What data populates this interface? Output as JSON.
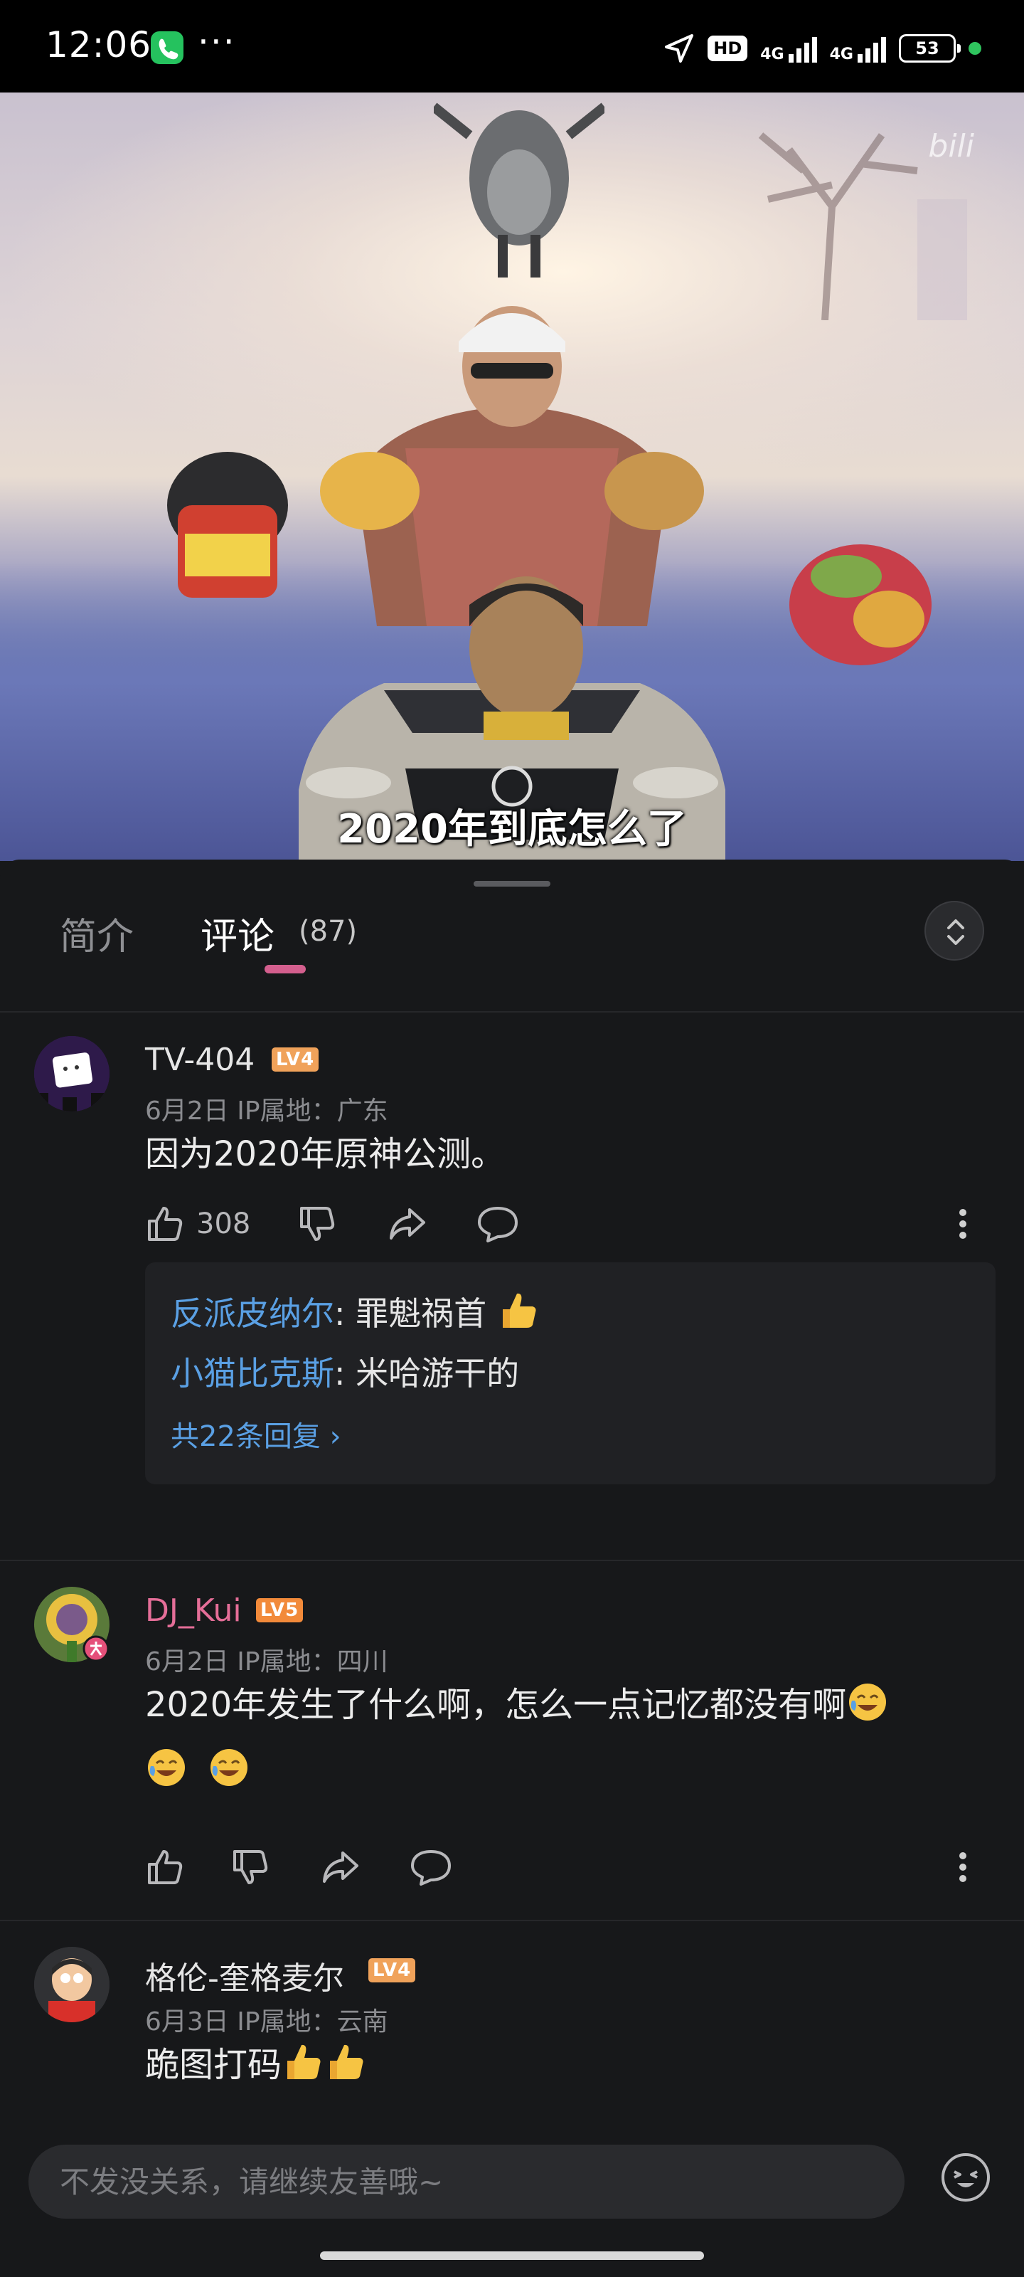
{
  "status_bar": {
    "time": "12:06",
    "more": "···",
    "hd": "HD",
    "net1": "4G",
    "net2": "4G",
    "battery": "53"
  },
  "video": {
    "caption": "2020年到底怎么了",
    "watermark": "bili"
  },
  "tabs": {
    "intro": "简介",
    "comments": "评论",
    "comments_count": "(87)"
  },
  "comments": [
    {
      "username": "TV-404",
      "username_color": "#e6e6e6",
      "level": "LV4",
      "level_color": "#f0a25a",
      "meta": "6月2日 IP属地：广东",
      "text": "因为2020年原神公测。",
      "likes": "308",
      "replies": [
        {
          "user": "反派皮纳尔",
          "text": ": 罪魁祸首"
        },
        {
          "user": "小猫比克斯",
          "text": ": 米哈游干的"
        }
      ],
      "reply_summary": "共22条回复 ›"
    },
    {
      "username": "DJ_Kui",
      "username_color": "#e56e98",
      "level": "LV5",
      "level_color": "#f28a3a",
      "meta": "6月2日 IP属地：四川",
      "text": "2020年发生了什么啊，怎么一点记忆都没有啊"
    },
    {
      "username": "格伦-奎格麦尔",
      "username_color": "#e6e6e6",
      "level": "LV4",
      "level_color": "#f0a25a",
      "meta": "6月3日 IP属地：云南",
      "text": "跪图打码"
    }
  ],
  "input": {
    "placeholder": "不发没关系，请继续友善哦~"
  },
  "colors": {
    "accent": "#d45f8e",
    "link": "#5aa0e4",
    "background": "#17181a"
  }
}
